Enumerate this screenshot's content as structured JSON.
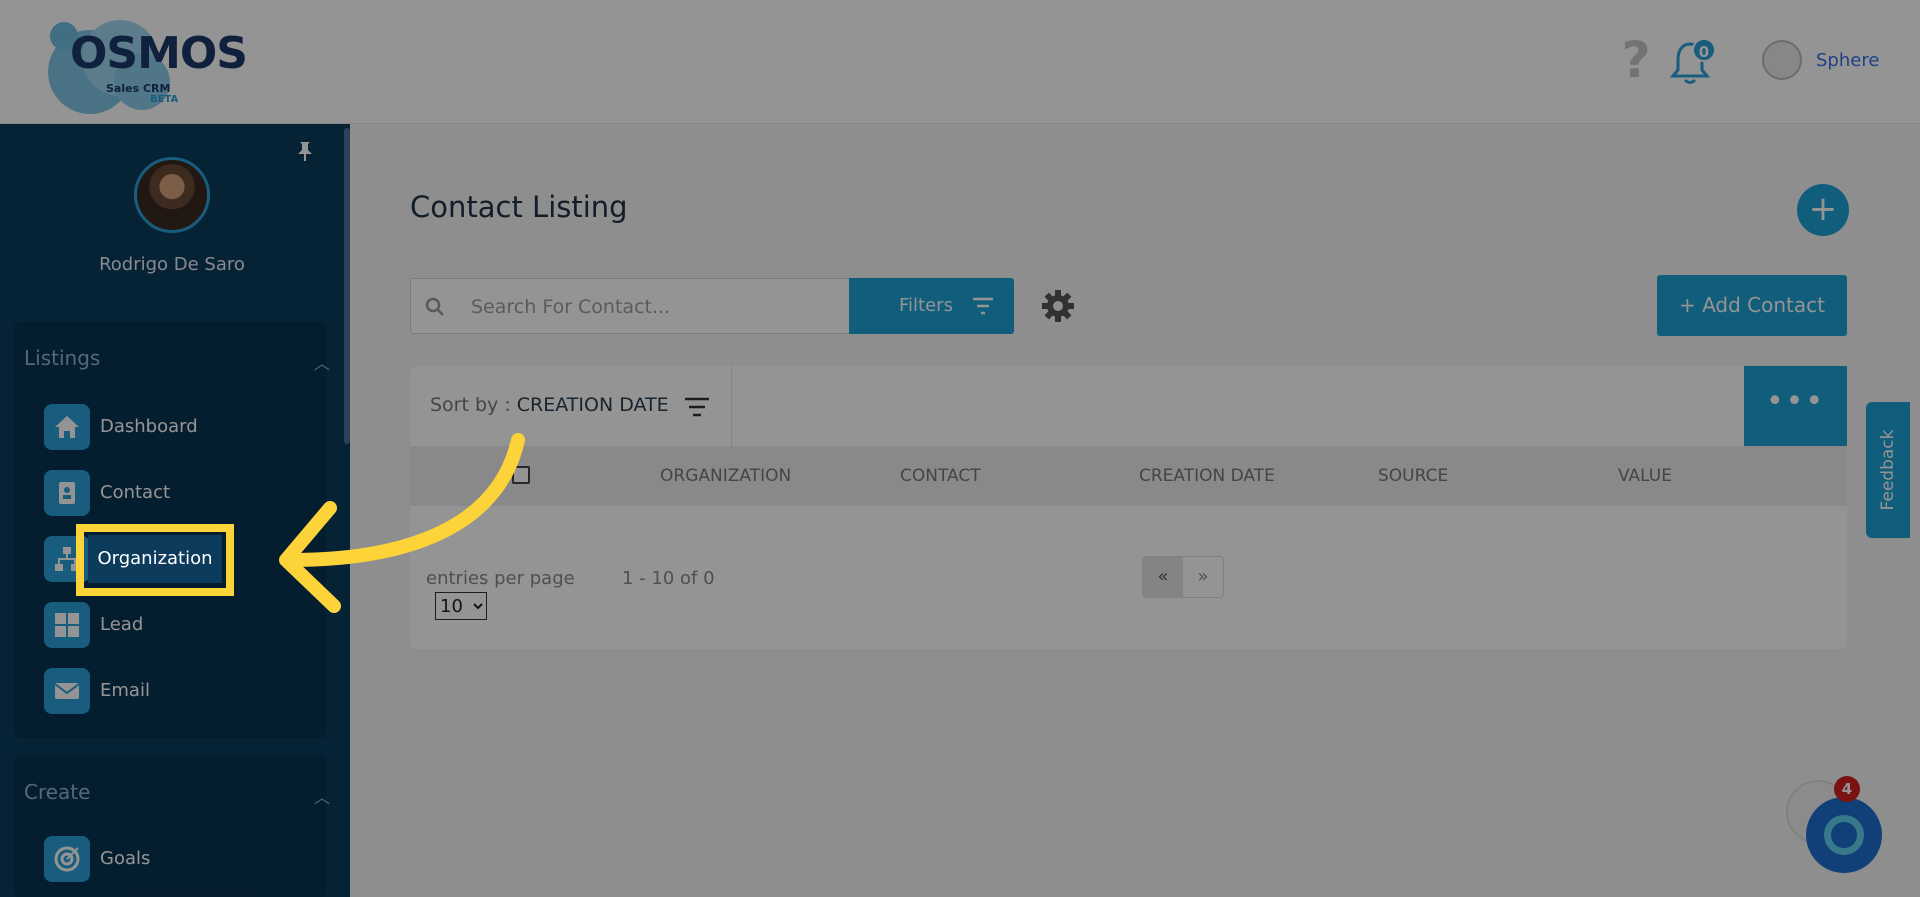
{
  "header": {
    "logo_text": "OSMOS",
    "logo_sub": "Sales CRM",
    "logo_beta": "BETA",
    "help_icon": "question-mark-icon",
    "notification_count": "0",
    "user_name": "Sphere"
  },
  "sidebar": {
    "profile_name": "Rodrigo De Saro",
    "listings_title": "Listings",
    "create_title": "Create",
    "items": [
      {
        "label": "Dashboard",
        "icon": "home-icon"
      },
      {
        "label": "Contact",
        "icon": "contact-card-icon"
      },
      {
        "label": "Organization",
        "icon": "org-chart-icon"
      },
      {
        "label": "Lead",
        "icon": "grid-icon"
      },
      {
        "label": "Email",
        "icon": "envelope-icon"
      }
    ],
    "create_items": [
      {
        "label": "Goals",
        "icon": "target-icon"
      }
    ]
  },
  "main": {
    "title": "Contact Listing",
    "search_placeholder": "Search For Contact...",
    "filters_label": "Filters",
    "add_contact_label": "+ Add Contact",
    "sort_prefix": "Sort by : ",
    "sort_value": "CREATION DATE",
    "more_label": "•••",
    "columns": [
      "ORGANIZATION",
      "CONTACT",
      "CREATION DATE",
      "SOURCE",
      "VALUE"
    ],
    "entries_label": "entries per page",
    "entries_value": "10",
    "range_text": "1 - 10 of 0",
    "pager_prev": "«",
    "pager_next": "»"
  },
  "feedback_label": "Feedback",
  "chat_badge": "4",
  "colors": {
    "accent": "#1ea0d6",
    "sidebar": "#0c3b5c",
    "highlight": "#fdd33a"
  }
}
